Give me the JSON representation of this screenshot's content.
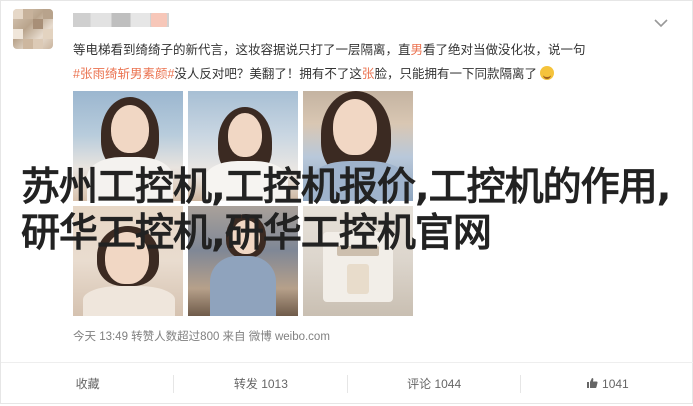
{
  "post": {
    "text_prefix": "等电梯看到绮绮子的新代言，这妆容据说只打了一层隔离，直",
    "hl1": "男",
    "text_mid1": "看了绝对当做没化妆，说一句",
    "topic": "#张雨绮斩男素颜#",
    "text_mid2": "没人反对吧？美翻了！拥有不了这",
    "hl2": "张",
    "text_suffix": "脸，只能拥有一下同款隔离了",
    "emoji": "laughing-emoji"
  },
  "overlay_title": "苏州工控机,工控机报价,工控机的作用,研华工控机,研华工控机官网",
  "meta": {
    "info": "今天 13:49 转赞人数超过800  来自 微博 weibo.com"
  },
  "footer": {
    "favorite_label": "收藏",
    "repost_label": "转发 1013",
    "comment_label": "评论 1044",
    "like_count": "1041"
  },
  "colors": {
    "accent": "#eb7350",
    "text": "#333333",
    "meta": "#808080"
  },
  "icons": {
    "more": "chevron-down-icon",
    "like": "thumbs-up-icon"
  }
}
